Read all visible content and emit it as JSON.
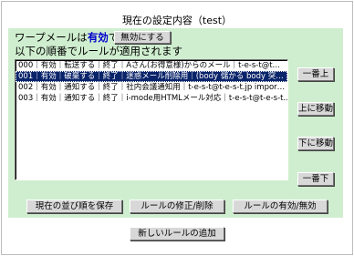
{
  "title": "現在の設定内容（test）",
  "status": {
    "prefix": "ワープメールは",
    "state": "有効",
    "suffix": "です",
    "disable_button": "無効にする",
    "order_note": "以下の順番でルールが適用されます"
  },
  "rules": [
    "000｜有効｜転送する｜終了｜Aさん(お得意様)からのメール｜t-e-s-t@t…",
    "001｜有効｜破棄する｜終了｜迷惑メール削除用｜(body 儲かる body 突…",
    "002｜有効｜通知する｜終了｜社内会議通知用｜t-e-s-t@t-e-s-t.jp impor…",
    "003｜有効｜通知する｜終了｜i-mode用HTMLメール対応｜t-e-s-t@t-e-s-t…"
  ],
  "selected_index": 1,
  "side_buttons": {
    "top": "一番上",
    "up": "上に移動",
    "down": "下に移動",
    "bottom": "一番下"
  },
  "bottom_buttons": {
    "save_order": "現在の並び順を保存",
    "edit_delete": "ルールの修正/削除",
    "toggle": "ルールの有効/無効",
    "add": "新しいルールの追加"
  }
}
